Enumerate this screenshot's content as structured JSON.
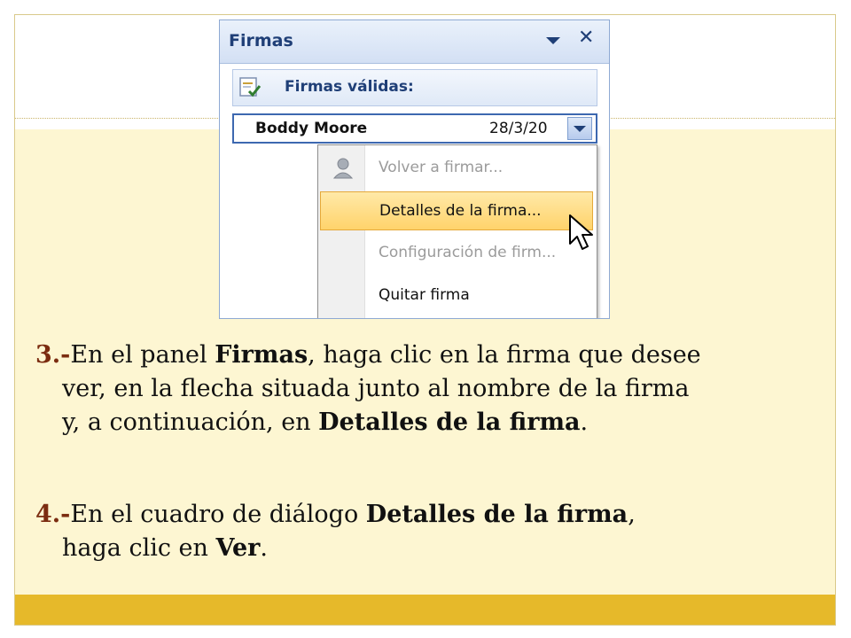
{
  "panel": {
    "title": "Firmas",
    "valid_label": "Firmas válidas:",
    "signer_name": "Boddy Moore",
    "signer_date": "28/3/20",
    "menu": [
      {
        "label": "Volver a firmar...",
        "enabled": false,
        "icon": "signer-icon"
      },
      {
        "label": "Detalles de la firma...",
        "enabled": true,
        "highlighted": true
      },
      {
        "label": "Configuración de firm...",
        "enabled": false
      },
      {
        "label": "Quitar firma",
        "enabled": true
      }
    ]
  },
  "steps": {
    "step3": {
      "num": "3.-",
      "l1a": "En el panel ",
      "l1b": "Firmas",
      "l1c": ", haga clic en la firma que desee",
      "l2": "ver, en la flecha situada junto al nombre de la firma",
      "l3a": "y, a continuación, en ",
      "l3b": "Detalles de la firma",
      "l3c": "."
    },
    "step4": {
      "num": "4.-",
      "l1a": "En el cuadro de diálogo ",
      "l1b": "Detalles de la firma",
      "l1c": ",",
      "l2a": "haga clic en ",
      "l2b": "Ver",
      "l2c": "."
    }
  },
  "colors": {
    "background": "#fdf6d2",
    "accent_bar": "#e6b92a",
    "step_number": "#7b2c10",
    "panel_title": "#1f3f77",
    "menu_highlight": "#ffd36b"
  }
}
